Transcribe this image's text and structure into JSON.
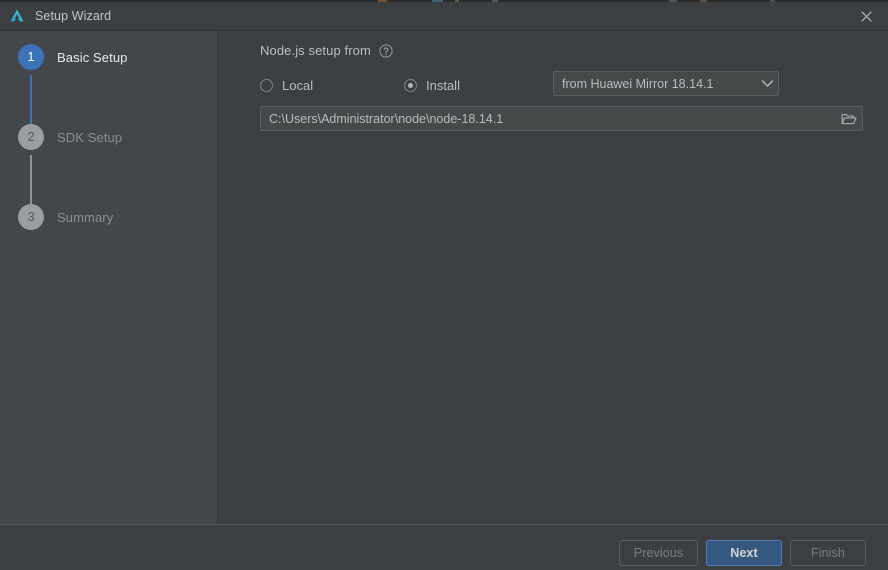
{
  "window": {
    "title": "Setup Wizard",
    "logo_icon": "deveco-logo-icon",
    "close_icon": "close-icon"
  },
  "sidebar": {
    "steps": [
      {
        "number": "1",
        "label": "Basic Setup",
        "state": "active"
      },
      {
        "number": "2",
        "label": "SDK Setup",
        "state": "idle"
      },
      {
        "number": "3",
        "label": "Summary",
        "state": "idle"
      }
    ]
  },
  "main": {
    "section_title": "Node.js setup from",
    "help_icon": "help-circle-icon",
    "radio_options": [
      {
        "label": "Local",
        "selected": false
      },
      {
        "label": "Install",
        "selected": true
      }
    ],
    "mirror_select": {
      "value": "from Huawei Mirror 18.14.1",
      "arrow_icon": "chevron-down-icon"
    },
    "path_field": {
      "value": "C:\\Users\\Administrator\\node\\node-18.14.1",
      "placeholder": "Node.js installation path",
      "browse_icon": "folder-open-icon"
    }
  },
  "footer": {
    "buttons": [
      {
        "label": "Previous",
        "state": "disabled"
      },
      {
        "label": "Next",
        "state": "primary"
      },
      {
        "label": "Finish",
        "state": "disabled"
      }
    ]
  },
  "colors": {
    "titlebar_bg": "#3c3f41",
    "sidebar_bg": "#43464b",
    "content_bg": "#3c3f41",
    "accent_blue": "#3c72b6",
    "primary_button_bg": "#365880",
    "primary_button_border": "#4d7db5",
    "field_bg": "#45494a",
    "field_border": "#5a5d5f",
    "text_primary": "#bcbec0",
    "text_muted": "#8b9096",
    "text_disabled": "#787c80"
  }
}
